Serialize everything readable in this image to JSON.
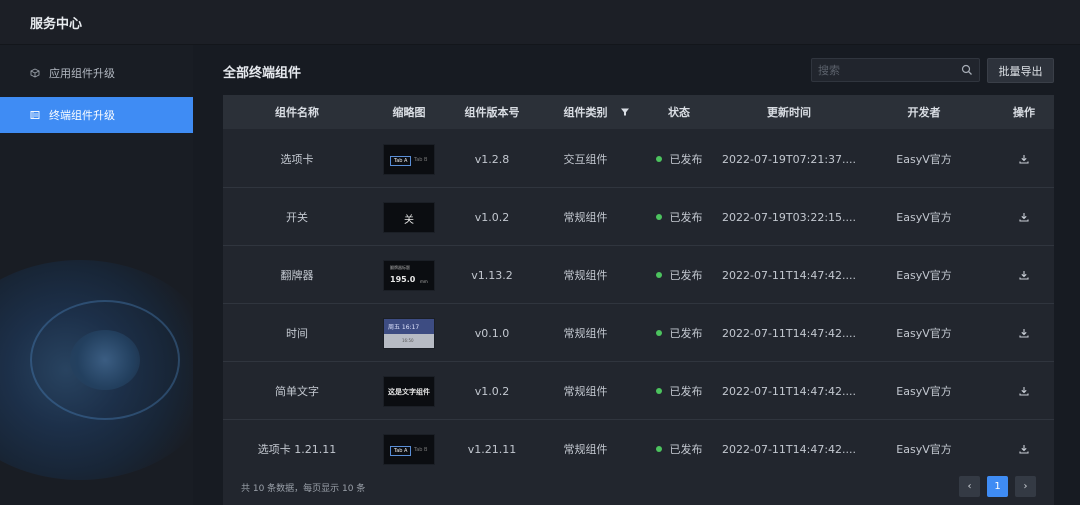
{
  "header": {
    "title": "服务中心"
  },
  "sidebar": {
    "items": [
      {
        "label": "应用组件升级",
        "active": false,
        "icon": "cube-icon"
      },
      {
        "label": "终端组件升级",
        "active": true,
        "icon": "list-icon"
      }
    ]
  },
  "main": {
    "title": "全部终端组件",
    "search_placeholder": "搜索",
    "export_label": "批量导出"
  },
  "table": {
    "columns": [
      "组件名称",
      "缩略图",
      "组件版本号",
      "组件类别",
      "状态",
      "更新时间",
      "开发者",
      "操作"
    ],
    "rows": [
      {
        "name": "选项卡",
        "thumb": "tabs",
        "version": "v1.2.8",
        "category": "交互组件",
        "status": "已发布",
        "updated": "2022-07-19T07:21:37....",
        "developer": "EasyV官方"
      },
      {
        "name": "开关",
        "thumb": "switch",
        "version": "v1.0.2",
        "category": "常规组件",
        "status": "已发布",
        "updated": "2022-07-19T03:22:15....",
        "developer": "EasyV官方"
      },
      {
        "name": "翻牌器",
        "thumb": "flipper",
        "version": "v1.13.2",
        "category": "常规组件",
        "status": "已发布",
        "updated": "2022-07-11T14:47:42....",
        "developer": "EasyV官方"
      },
      {
        "name": "时间",
        "thumb": "time",
        "version": "v0.1.0",
        "category": "常规组件",
        "status": "已发布",
        "updated": "2022-07-11T14:47:42....",
        "developer": "EasyV官方"
      },
      {
        "name": "简单文字",
        "thumb": "text",
        "version": "v1.0.2",
        "category": "常规组件",
        "status": "已发布",
        "updated": "2022-07-11T14:47:42....",
        "developer": "EasyV官方"
      },
      {
        "name": "选项卡 1.21.11",
        "thumb": "tabs",
        "version": "v1.21.11",
        "category": "常规组件",
        "status": "已发布",
        "updated": "2022-07-11T14:47:42....",
        "developer": "EasyV官方"
      }
    ]
  },
  "thumbs": {
    "tabs": {
      "a": "Tab A",
      "b": "Tab B"
    },
    "switch": {
      "label": "关"
    },
    "flipper": {
      "caption": "翻牌器标题",
      "value": "195.0",
      "unit": "mm"
    },
    "time": {
      "line1": "周五 16:17",
      "line2": "16:50"
    },
    "text": {
      "label": "这是文字组件"
    }
  },
  "pagination": {
    "summary": "共 10 条数据，每页显示 10 条",
    "current": "1",
    "prev": "‹",
    "next": "›"
  },
  "colors": {
    "accent": "#3f8cf4",
    "published": "#4cc35e"
  }
}
